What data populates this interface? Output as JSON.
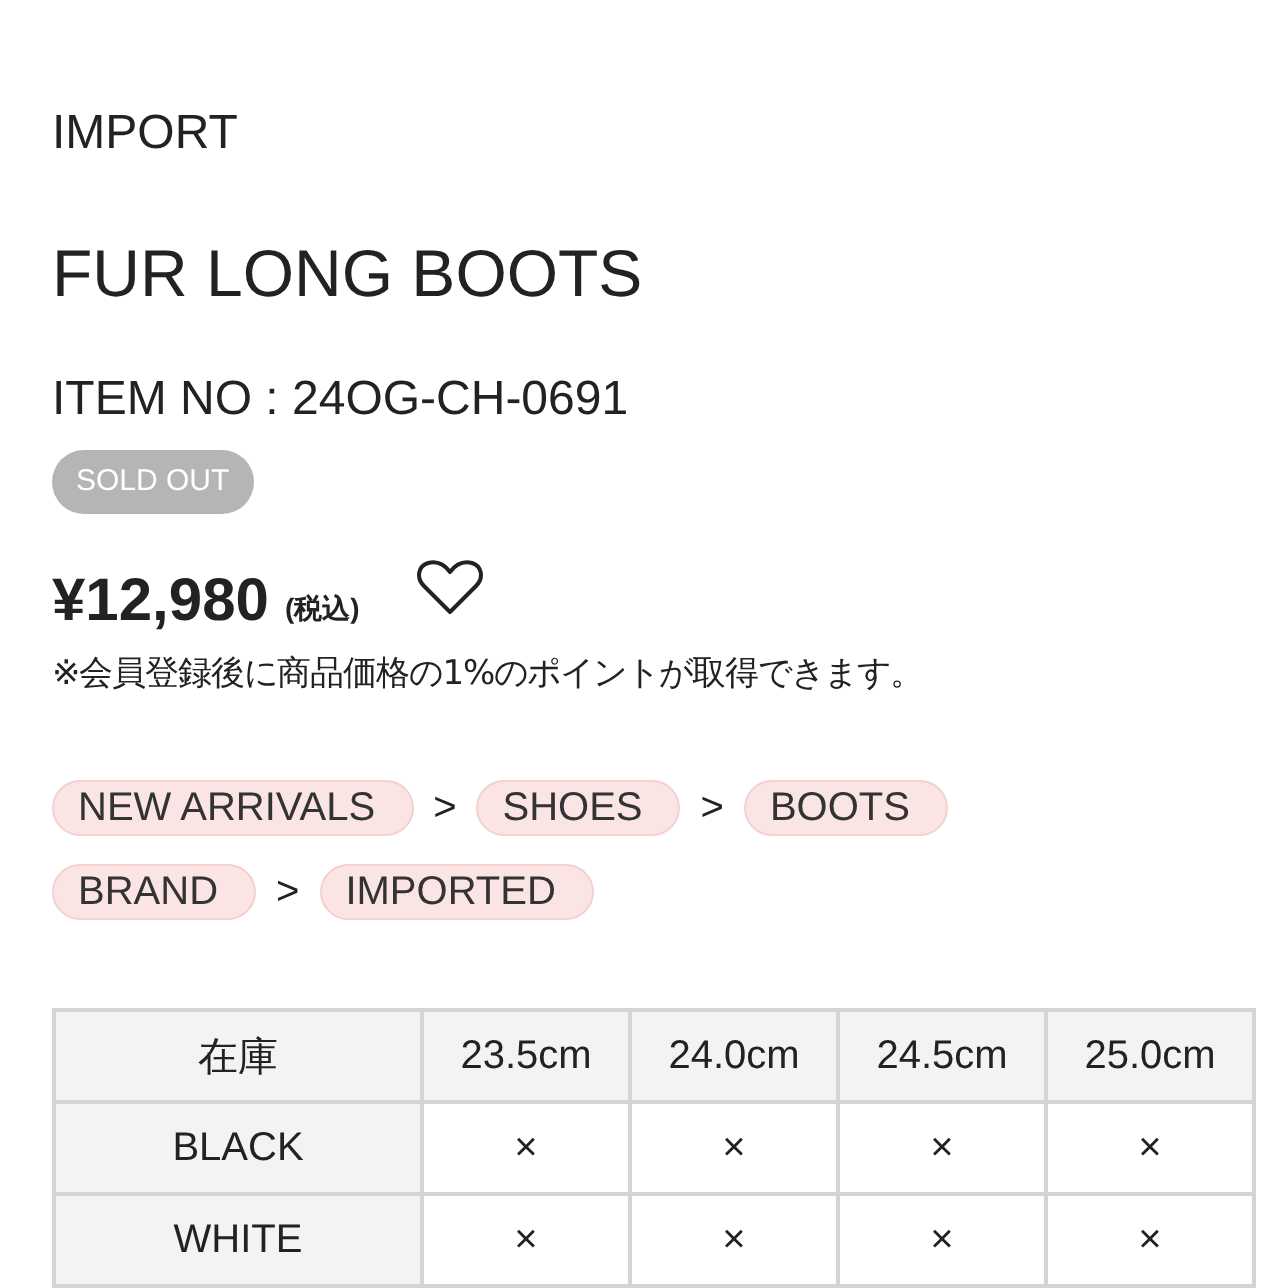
{
  "brand": "IMPORT",
  "title": "FUR LONG BOOTS",
  "item_no": "ITEM NO : 24OG-CH-0691",
  "badge": "SOLD OUT",
  "price": {
    "amount": "¥12,980",
    "tax_note": "(税込)",
    "favorite": false
  },
  "points_note": "※会員登録後に商品価格の1%のポイントが取得できます。",
  "breadcrumb_rows": [
    [
      {
        "kind": "chip",
        "text": "NEW ARRIVALS"
      },
      {
        "kind": "separator",
        "text": ">"
      },
      {
        "kind": "chip",
        "text": "SHOES"
      },
      {
        "kind": "separator",
        "text": ">"
      },
      {
        "kind": "chip",
        "text": "BOOTS"
      }
    ],
    [
      {
        "kind": "chip",
        "text": "BRAND"
      },
      {
        "kind": "separator",
        "text": ">"
      },
      {
        "kind": "chip",
        "text": "IMPORTED"
      }
    ]
  ],
  "stock_table": {
    "columns": [
      "在庫",
      "23.5cm",
      "24.0cm",
      "24.5cm",
      "25.0cm"
    ],
    "rows": [
      {
        "cells": [
          "BLACK",
          "×",
          "×",
          "×",
          "×"
        ]
      },
      {
        "cells": [
          "WHITE",
          "×",
          "×",
          "×",
          "×"
        ]
      }
    ]
  }
}
